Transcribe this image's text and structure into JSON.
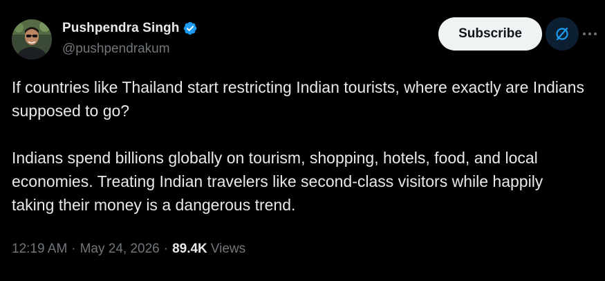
{
  "author": {
    "display_name": "Pushpendra Singh",
    "handle": "@pushpendrakum",
    "verified": true,
    "verified_color": "#1d9bf0"
  },
  "actions": {
    "subscribe_label": "Subscribe",
    "grok_icon": "grok-icon",
    "more_icon": "more-horizontal-icon"
  },
  "tweet": {
    "paragraphs": [
      "If countries like Thailand start restricting Indian tourists, where exactly are Indians supposed to go?",
      "Indians spend billions globally on tourism, shopping, hotels, food, and local economies. Treating Indian travelers like second-class visitors while happily taking their money is a dangerous trend."
    ]
  },
  "meta": {
    "time": "12:19 AM",
    "separator": "·",
    "date": "May 24, 2026",
    "views_count": "89.4K",
    "views_label": "Views"
  },
  "colors": {
    "background": "#000000",
    "primary_text": "#e7e9ea",
    "secondary_text": "#71767b",
    "subscribe_bg": "#eff3f4",
    "grok_bg": "#0d1f33",
    "accent": "#1d9bf0"
  }
}
